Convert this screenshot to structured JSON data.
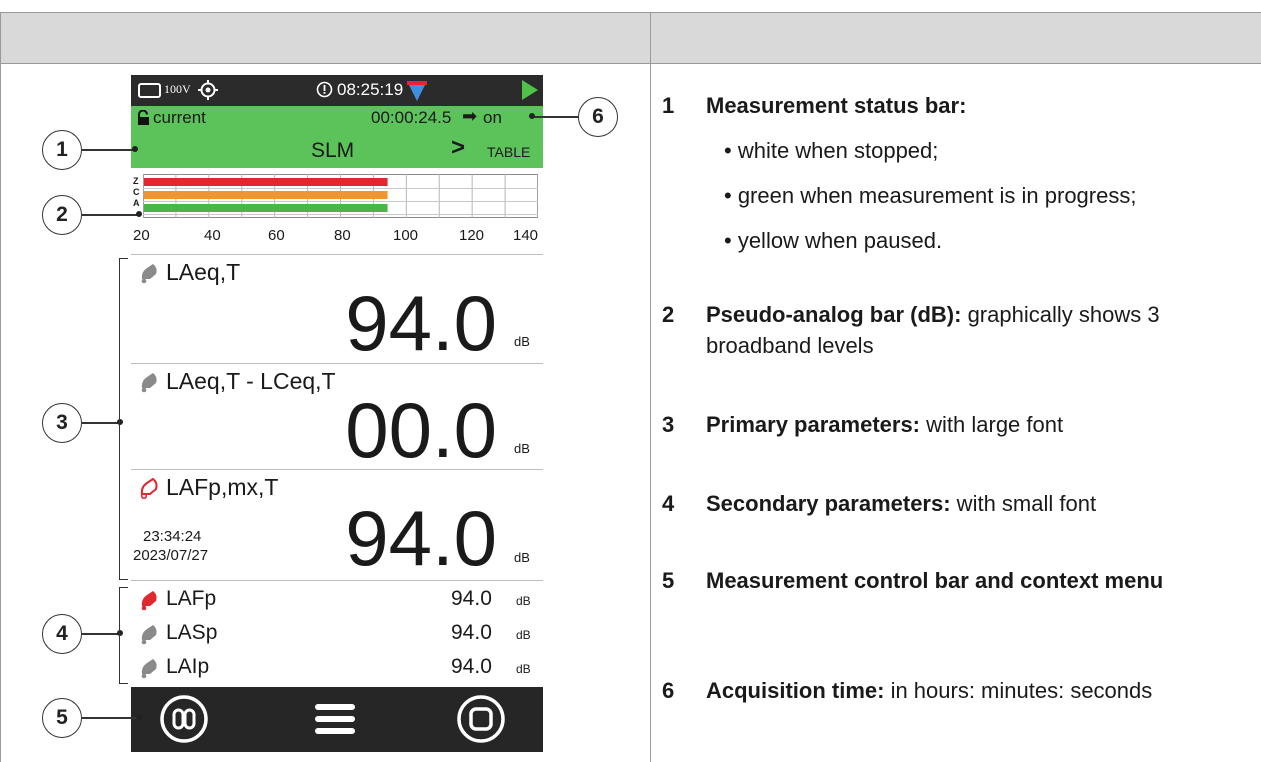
{
  "device": {
    "sys": {
      "battery_text": "100V",
      "clock": "08:25:19"
    },
    "status": {
      "lock_label": "current",
      "elapsed": "00:00:24.5",
      "trigger": "on",
      "mode": "SLM",
      "arrow": ">",
      "view": "TABLE"
    },
    "bar": {
      "labels": [
        "Z",
        "C",
        "A"
      ],
      "ticks": [
        "20",
        "40",
        "60",
        "80",
        "100",
        "120",
        "140"
      ],
      "levels": [
        {
          "name": "Z",
          "value": 94,
          "color": "#e0282f"
        },
        {
          "name": "C",
          "value": 94,
          "color": "#f0962d"
        },
        {
          "name": "A",
          "value": 94,
          "color": "#49b64a"
        }
      ],
      "range": [
        20,
        140
      ]
    },
    "primary": [
      {
        "name": "LAeq,T",
        "value": "94.0",
        "unit": "dB"
      },
      {
        "name": "LAeq,T - LCeq,T",
        "value": "00.0",
        "unit": "dB"
      },
      {
        "name": "LAFp,mx,T",
        "value": "94.0",
        "unit": "dB",
        "time": "23:34:24",
        "date": "2023/07/27"
      }
    ],
    "secondary": [
      {
        "name": "LAFp",
        "value": "94.0",
        "unit": "dB"
      },
      {
        "name": "LASp",
        "value": "94.0",
        "unit": "dB"
      },
      {
        "name": "LAIp",
        "value": "94.0",
        "unit": "dB"
      }
    ]
  },
  "callouts": [
    "1",
    "2",
    "3",
    "4",
    "5",
    "6"
  ],
  "descriptions": {
    "d1": {
      "num": "1",
      "title": "Measurement status bar:",
      "bullets": [
        "• white when stopped;",
        "• green when measurement is in progress;",
        "• yellow when paused."
      ]
    },
    "d2": {
      "num": "2",
      "title": "Pseudo-analog bar (dB):",
      "rest": " graphically shows 3 broadband levels"
    },
    "d3": {
      "num": "3",
      "title": "Primary parameters:",
      "rest": " with large font"
    },
    "d4": {
      "num": "4",
      "title": "Secondary parameters:",
      "rest": " with small font"
    },
    "d5": {
      "num": "5",
      "title": "Measurement control bar and context menu"
    },
    "d6": {
      "num": "6",
      "title": "Acquisition time:",
      "rest": " in hours: minutes: seconds"
    }
  },
  "colors": {
    "status_green": "#5cc25a",
    "header_gray": "#d9d9d9",
    "control_dark": "#262626"
  }
}
